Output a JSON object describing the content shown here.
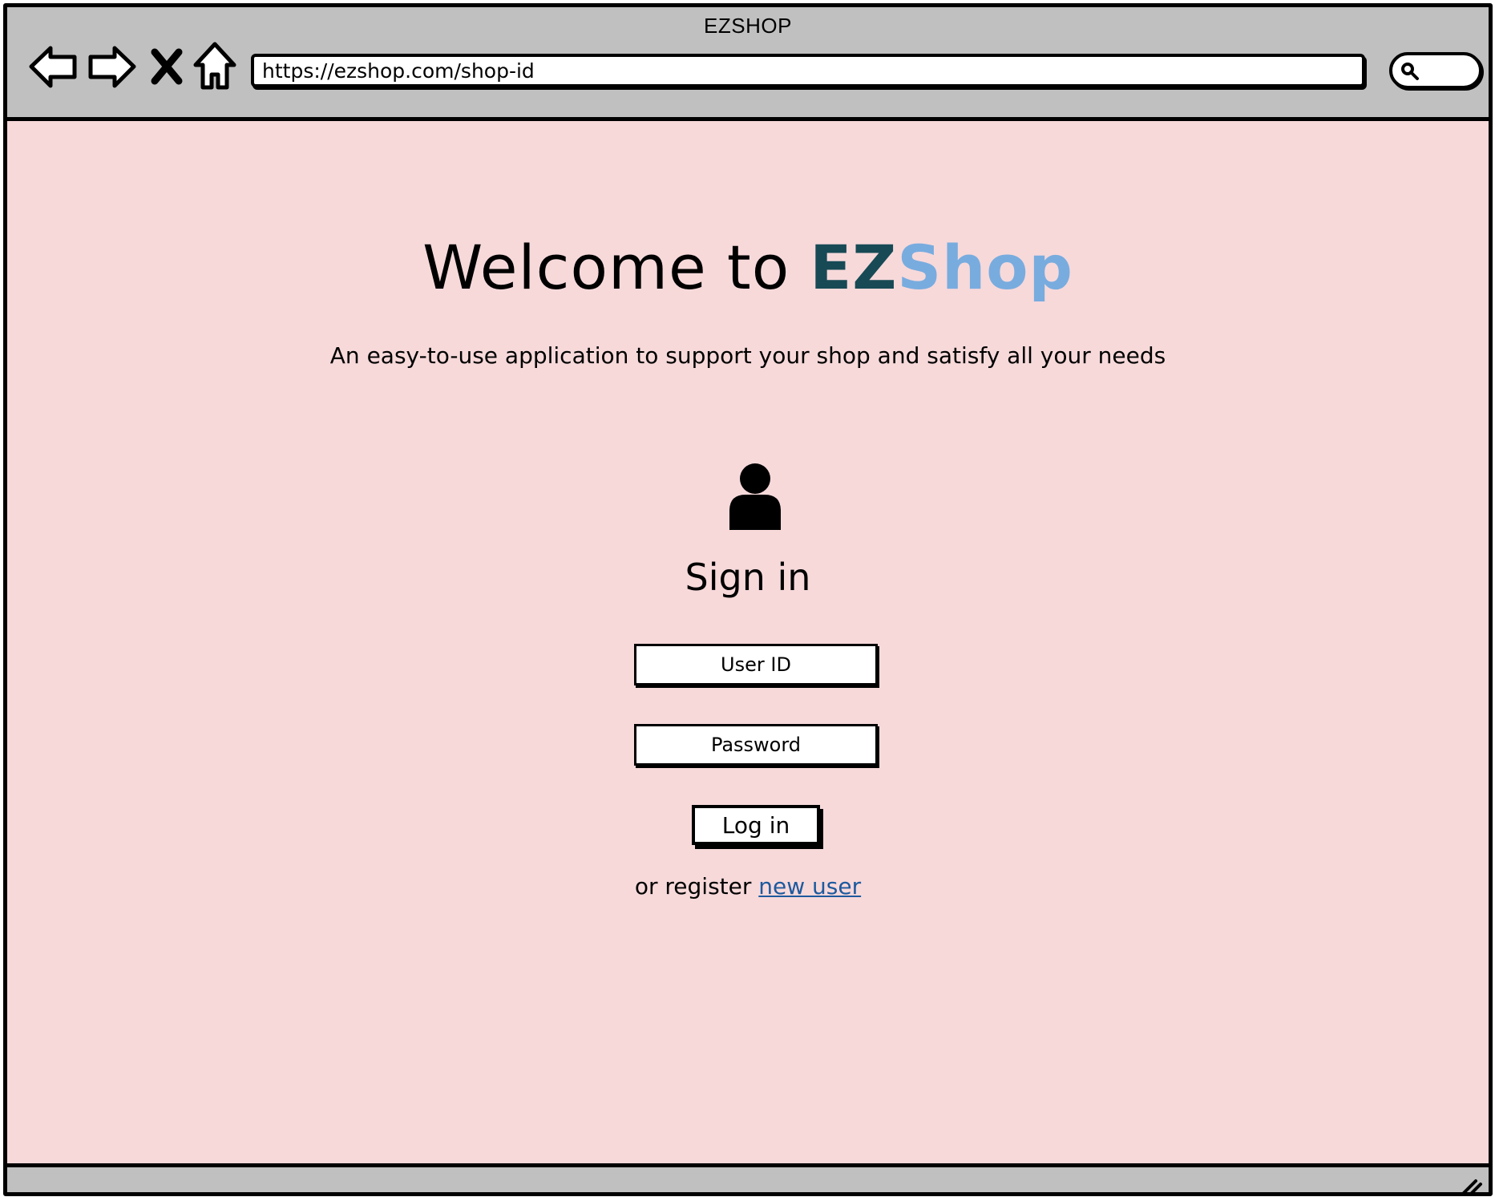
{
  "window": {
    "title": "EZSHOP"
  },
  "toolbar": {
    "buttons": [
      {
        "name": "back",
        "icon": "arrow-left-icon"
      },
      {
        "name": "forward",
        "icon": "arrow-right-icon"
      },
      {
        "name": "stop",
        "icon": "close-icon"
      },
      {
        "name": "home",
        "icon": "home-icon"
      }
    ],
    "url": "https://ezshop.com/shop-id",
    "search_icon": "search-icon"
  },
  "page": {
    "background": "#f7d9da",
    "heading_prefix": "Welcome to ",
    "brand_part1": "EZ",
    "brand_part2": "Shop",
    "brand_color1": "#174a55",
    "brand_color2": "#78acdf",
    "subtitle": "An easy-to-use application to support your shop and satisfy all your needs",
    "user_icon": "user-icon",
    "signin_title": "Sign in",
    "userid_placeholder": "User ID",
    "password_placeholder": "Password",
    "login_label": "Log in",
    "register_prefix": "or register ",
    "register_link": "new user",
    "link_color": "#1d5a9e"
  }
}
